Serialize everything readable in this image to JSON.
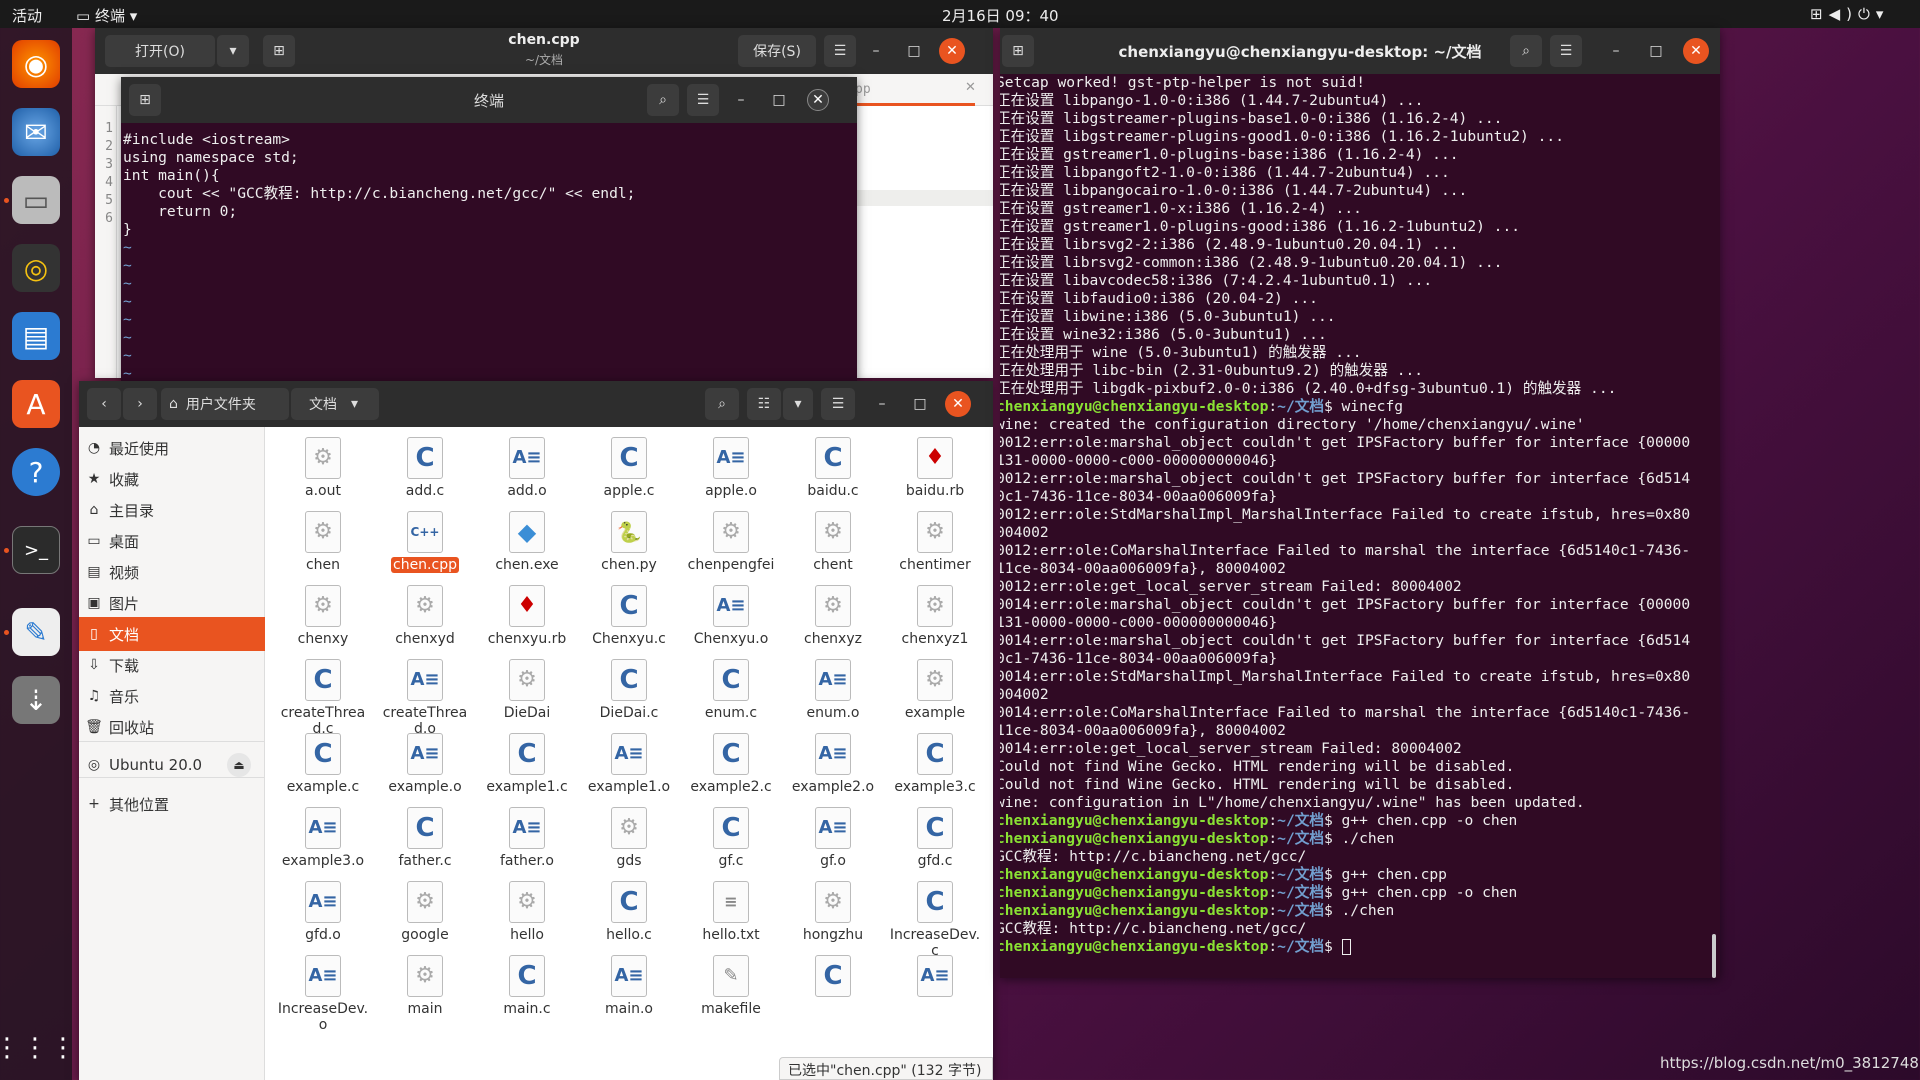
{
  "topbar": {
    "activities": "活动",
    "app_menu": "终端",
    "clock": "2月16日  09：40"
  },
  "gedit": {
    "open_label": "打开(O)",
    "title": "chen.cpp",
    "subtitle": "~/文档",
    "save_label": "保存(S)",
    "tab_fragment": "pp",
    "line_numbers": [
      "1",
      "2",
      "3",
      "4",
      "5",
      "6"
    ]
  },
  "vim_terminal": {
    "title": "终端",
    "code_lines": [
      "#include <iostream>",
      "using namespace std;",
      "int main(){",
      "    cout << \"GCC教程: http://c.biancheng.net/gcc/\" << endl;",
      "    return 0;",
      "}"
    ],
    "tilde": "~"
  },
  "files": {
    "home_crumb": "用户文件夹",
    "docs_crumb": "文档",
    "sidebar": [
      {
        "icon": "clock-icon",
        "glyph": "◔",
        "label": "最近使用"
      },
      {
        "icon": "star-icon",
        "glyph": "★",
        "label": "收藏"
      },
      {
        "icon": "home-icon",
        "glyph": "⌂",
        "label": "主目录"
      },
      {
        "icon": "desktop-icon",
        "glyph": "▭",
        "label": "桌面"
      },
      {
        "icon": "video-icon",
        "glyph": "▤",
        "label": "视频"
      },
      {
        "icon": "image-icon",
        "glyph": "▣",
        "label": "图片"
      },
      {
        "icon": "document-icon",
        "glyph": "▯",
        "label": "文档"
      },
      {
        "icon": "download-icon",
        "glyph": "⇩",
        "label": "下载"
      },
      {
        "icon": "music-icon",
        "glyph": "♫",
        "label": "音乐"
      },
      {
        "icon": "trash-icon",
        "glyph": "🗑",
        "label": "回收站"
      },
      {
        "icon": "disk-icon",
        "glyph": "◎",
        "label": "Ubuntu 20.0"
      },
      {
        "icon": "plus-icon",
        "glyph": "+",
        "label": "其他位置"
      }
    ],
    "items": [
      {
        "name": "a.out",
        "kind": "g"
      },
      {
        "name": "add.c",
        "kind": "c"
      },
      {
        "name": "add.o",
        "kind": "o"
      },
      {
        "name": "apple.c",
        "kind": "c"
      },
      {
        "name": "apple.o",
        "kind": "o"
      },
      {
        "name": "baidu.c",
        "kind": "c"
      },
      {
        "name": "baidu.rb",
        "kind": "rb"
      },
      {
        "name": "chen",
        "kind": "g"
      },
      {
        "name": "chen.cpp",
        "kind": "cpp"
      },
      {
        "name": "chen.exe",
        "kind": "exe"
      },
      {
        "name": "chen.py",
        "kind": "py"
      },
      {
        "name": "chenpengfei",
        "kind": "g"
      },
      {
        "name": "chent",
        "kind": "g"
      },
      {
        "name": "chentimer",
        "kind": "g"
      },
      {
        "name": "chenxy",
        "kind": "g"
      },
      {
        "name": "chenxyd",
        "kind": "g"
      },
      {
        "name": "chenxyu.rb",
        "kind": "rb"
      },
      {
        "name": "Chenxyu.c",
        "kind": "c"
      },
      {
        "name": "Chenxyu.o",
        "kind": "o"
      },
      {
        "name": "chenxyz",
        "kind": "g"
      },
      {
        "name": "chenxyz1",
        "kind": "g"
      },
      {
        "name": "createThread.c",
        "kind": "c"
      },
      {
        "name": "createThread.o",
        "kind": "o"
      },
      {
        "name": "DieDai",
        "kind": "g"
      },
      {
        "name": "DieDai.c",
        "kind": "c"
      },
      {
        "name": "enum.c",
        "kind": "c"
      },
      {
        "name": "enum.o",
        "kind": "o"
      },
      {
        "name": "example",
        "kind": "g"
      },
      {
        "name": "example.c",
        "kind": "c"
      },
      {
        "name": "example.o",
        "kind": "o"
      },
      {
        "name": "example1.c",
        "kind": "c"
      },
      {
        "name": "example1.o",
        "kind": "o"
      },
      {
        "name": "example2.c",
        "kind": "c"
      },
      {
        "name": "example2.o",
        "kind": "o"
      },
      {
        "name": "example3.c",
        "kind": "c"
      },
      {
        "name": "example3.o",
        "kind": "o"
      },
      {
        "name": "father.c",
        "kind": "c"
      },
      {
        "name": "father.o",
        "kind": "o"
      },
      {
        "name": "gds",
        "kind": "g"
      },
      {
        "name": "gf.c",
        "kind": "c"
      },
      {
        "name": "gf.o",
        "kind": "o"
      },
      {
        "name": "gfd.c",
        "kind": "c"
      },
      {
        "name": "gfd.o",
        "kind": "o"
      },
      {
        "name": "google",
        "kind": "g"
      },
      {
        "name": "hello",
        "kind": "g"
      },
      {
        "name": "hello.c",
        "kind": "c"
      },
      {
        "name": "hello.txt",
        "kind": "txt"
      },
      {
        "name": "hongzhu",
        "kind": "g"
      },
      {
        "name": "IncreaseDev.c",
        "kind": "c"
      },
      {
        "name": "IncreaseDev.o",
        "kind": "o"
      },
      {
        "name": "main",
        "kind": "g"
      },
      {
        "name": "main.c",
        "kind": "c"
      },
      {
        "name": "main.o",
        "kind": "o"
      },
      {
        "name": "makefile",
        "kind": "mk"
      },
      {
        "name": "",
        "kind": "c"
      },
      {
        "name": "",
        "kind": "o"
      }
    ],
    "selected": "chen.cpp",
    "status": "已选中\"chen.cpp\" (132 字节)"
  },
  "main_terminal": {
    "title": "chenxiangyu@chenxiangyu-desktop: ~/文档",
    "user": "chenxiangyu@chenxiangyu-desktop",
    "path": "~/文档",
    "lines": [
      {
        "t": "out",
        "s": "Setcap worked! gst-ptp-helper is not suid!"
      },
      {
        "t": "out",
        "s": "正在设置 libpango-1.0-0:i386 (1.44.7-2ubuntu4) ..."
      },
      {
        "t": "out",
        "s": "正在设置 libgstreamer-plugins-base1.0-0:i386 (1.16.2-4) ..."
      },
      {
        "t": "out",
        "s": "正在设置 libgstreamer-plugins-good1.0-0:i386 (1.16.2-1ubuntu2) ..."
      },
      {
        "t": "out",
        "s": "正在设置 gstreamer1.0-plugins-base:i386 (1.16.2-4) ..."
      },
      {
        "t": "out",
        "s": "正在设置 libpangoft2-1.0-0:i386 (1.44.7-2ubuntu4) ..."
      },
      {
        "t": "out",
        "s": "正在设置 libpangocairo-1.0-0:i386 (1.44.7-2ubuntu4) ..."
      },
      {
        "t": "out",
        "s": "正在设置 gstreamer1.0-x:i386 (1.16.2-4) ..."
      },
      {
        "t": "out",
        "s": "正在设置 gstreamer1.0-plugins-good:i386 (1.16.2-1ubuntu2) ..."
      },
      {
        "t": "out",
        "s": "正在设置 librsvg2-2:i386 (2.48.9-1ubuntu0.20.04.1) ..."
      },
      {
        "t": "out",
        "s": "正在设置 librsvg2-common:i386 (2.48.9-1ubuntu0.20.04.1) ..."
      },
      {
        "t": "out",
        "s": "正在设置 libavcodec58:i386 (7:4.2.4-1ubuntu0.1) ..."
      },
      {
        "t": "out",
        "s": "正在设置 libfaudio0:i386 (20.04-2) ..."
      },
      {
        "t": "out",
        "s": "正在设置 libwine:i386 (5.0-3ubuntu1) ..."
      },
      {
        "t": "out",
        "s": "正在设置 wine32:i386 (5.0-3ubuntu1) ..."
      },
      {
        "t": "out",
        "s": "正在处理用于 wine (5.0-3ubuntu1) 的触发器 ..."
      },
      {
        "t": "out",
        "s": "正在处理用于 libc-bin (2.31-0ubuntu9.2) 的触发器 ..."
      },
      {
        "t": "out",
        "s": "正在处理用于 libgdk-pixbuf2.0-0:i386 (2.40.0+dfsg-3ubuntu0.1) 的触发器 ..."
      },
      {
        "t": "cmd",
        "s": " winecfg"
      },
      {
        "t": "out",
        "s": "wine: created the configuration directory '/home/chenxiangyu/.wine'"
      },
      {
        "t": "out",
        "s": "0012:err:ole:marshal_object couldn't get IPSFactory buffer for interface {00000"
      },
      {
        "t": "out",
        "s": "131-0000-0000-c000-000000000046}"
      },
      {
        "t": "out",
        "s": "0012:err:ole:marshal_object couldn't get IPSFactory buffer for interface {6d514"
      },
      {
        "t": "out",
        "s": "0c1-7436-11ce-8034-00aa006009fa}"
      },
      {
        "t": "out",
        "s": "0012:err:ole:StdMarshalImpl_MarshalInterface Failed to create ifstub, hres=0x80"
      },
      {
        "t": "out",
        "s": "004002"
      },
      {
        "t": "out",
        "s": "0012:err:ole:CoMarshalInterface Failed to marshal the interface {6d5140c1-7436-"
      },
      {
        "t": "out",
        "s": "11ce-8034-00aa006009fa}, 80004002"
      },
      {
        "t": "out",
        "s": "0012:err:ole:get_local_server_stream Failed: 80004002"
      },
      {
        "t": "out",
        "s": "0014:err:ole:marshal_object couldn't get IPSFactory buffer for interface {00000"
      },
      {
        "t": "out",
        "s": "131-0000-0000-c000-000000000046}"
      },
      {
        "t": "out",
        "s": "0014:err:ole:marshal_object couldn't get IPSFactory buffer for interface {6d514"
      },
      {
        "t": "out",
        "s": "0c1-7436-11ce-8034-00aa006009fa}"
      },
      {
        "t": "out",
        "s": "0014:err:ole:StdMarshalImpl_MarshalInterface Failed to create ifstub, hres=0x80"
      },
      {
        "t": "out",
        "s": "004002"
      },
      {
        "t": "out",
        "s": "0014:err:ole:CoMarshalInterface Failed to marshal the interface {6d5140c1-7436-"
      },
      {
        "t": "out",
        "s": "11ce-8034-00aa006009fa}, 80004002"
      },
      {
        "t": "out",
        "s": "0014:err:ole:get_local_server_stream Failed: 80004002"
      },
      {
        "t": "out",
        "s": "Could not find Wine Gecko. HTML rendering will be disabled."
      },
      {
        "t": "out",
        "s": "Could not find Wine Gecko. HTML rendering will be disabled."
      },
      {
        "t": "out",
        "s": "wine: configuration in L\"/home/chenxiangyu/.wine\" has been updated."
      },
      {
        "t": "cmd",
        "s": " g++ chen.cpp -o chen"
      },
      {
        "t": "cmd",
        "s": " ./chen"
      },
      {
        "t": "out",
        "s": "GCC教程: http://c.biancheng.net/gcc/"
      },
      {
        "t": "cmd",
        "s": " g++ chen.cpp"
      },
      {
        "t": "cmd",
        "s": " g++ chen.cpp -o chen"
      },
      {
        "t": "cmd",
        "s": " ./chen"
      },
      {
        "t": "out",
        "s": "GCC教程: http://c.biancheng.net/gcc/"
      },
      {
        "t": "cursor",
        "s": " "
      }
    ]
  },
  "watermark": "https://blog.csdn.net/m0_38127487",
  "colors": {
    "accent": "#e95420",
    "terminal_bg": "#300a24",
    "prompt_green": "#8ae234",
    "path_blue": "#729fcf"
  }
}
